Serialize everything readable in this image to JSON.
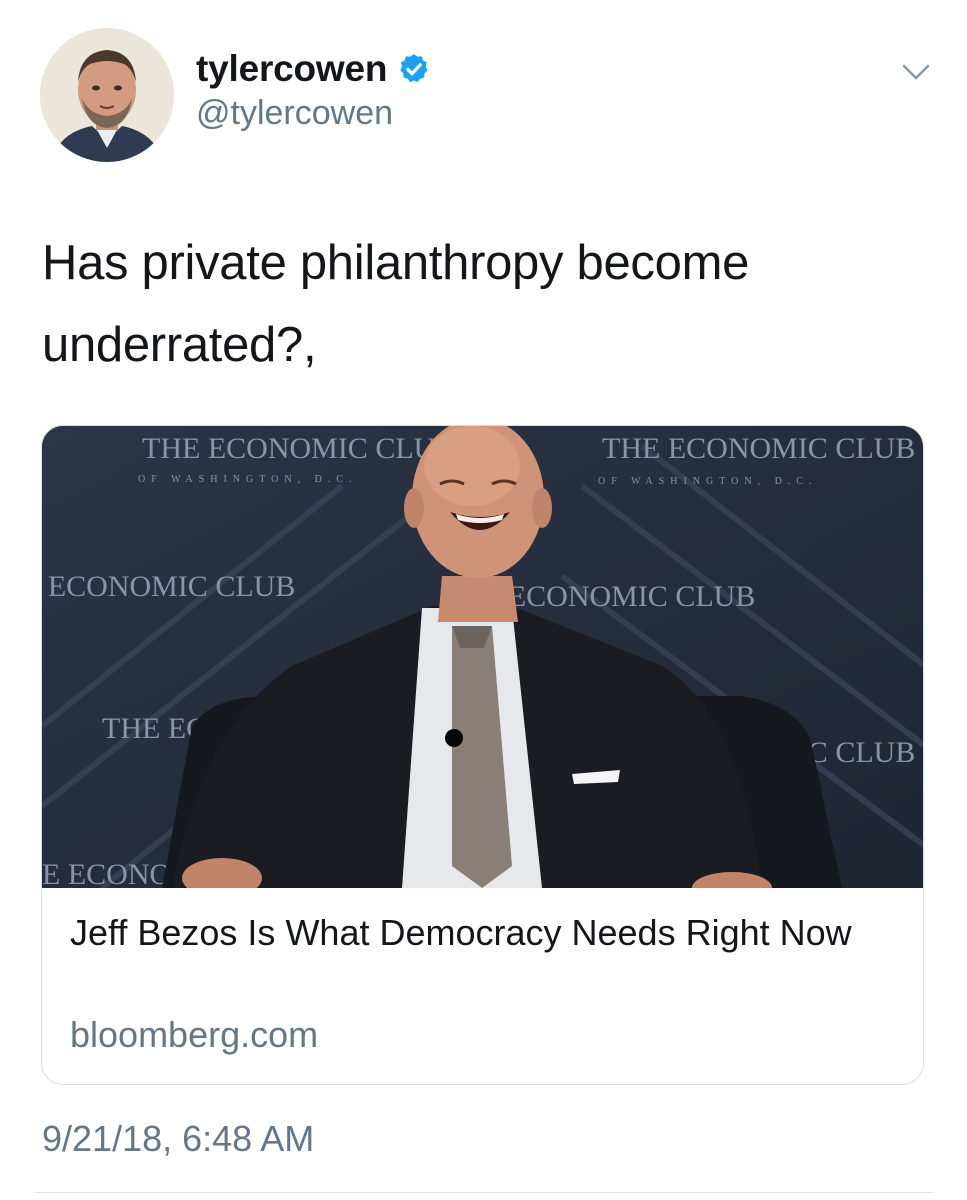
{
  "author": {
    "display_name": "tylercowen",
    "handle": "@tylercowen",
    "verified": true,
    "avatar_icon": "profile-photo"
  },
  "tweet": {
    "text": "Has private philanthropy become underrated?,",
    "timestamp": "9/21/18, 6:48 AM"
  },
  "card": {
    "title": "Jeff Bezos Is What Democracy Needs Right Now",
    "domain": "bloomberg.com",
    "backdrop_text": "THE ECONOMIC CLUB",
    "backdrop_subtext": "OF WASHINGTON, D.C."
  },
  "colors": {
    "verified_blue": "#1da1f2",
    "secondary_text": "#657786",
    "primary_text": "#14171a"
  },
  "icons": {
    "verified": "verified-badge-icon",
    "caret": "chevron-down-icon"
  }
}
